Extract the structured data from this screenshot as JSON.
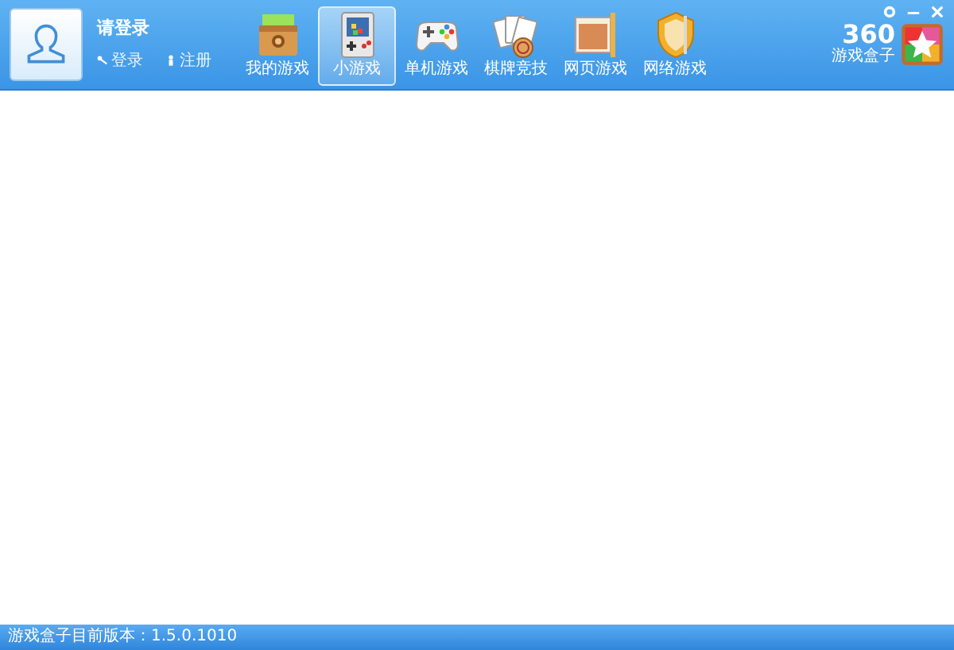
{
  "user": {
    "title": "请登录",
    "links": [
      {
        "label": "登录",
        "kind": "login"
      },
      {
        "label": "注册",
        "kind": "register"
      }
    ]
  },
  "tabs": [
    {
      "label": "我的游戏",
      "kind": "box",
      "selected": false
    },
    {
      "label": "小游戏",
      "kind": "handheld",
      "selected": true
    },
    {
      "label": "单机游戏",
      "kind": "gamepad",
      "selected": false
    },
    {
      "label": "棋牌竞技",
      "kind": "cards",
      "selected": false
    },
    {
      "label": "网页游戏",
      "kind": "scroll",
      "selected": false
    },
    {
      "label": "网络游戏",
      "kind": "shield",
      "selected": false
    }
  ],
  "logo": {
    "number": "360",
    "name": "游戏盒子"
  },
  "status_bar": {
    "text": "游戏盒子目前版本：1.5.0.1010"
  }
}
